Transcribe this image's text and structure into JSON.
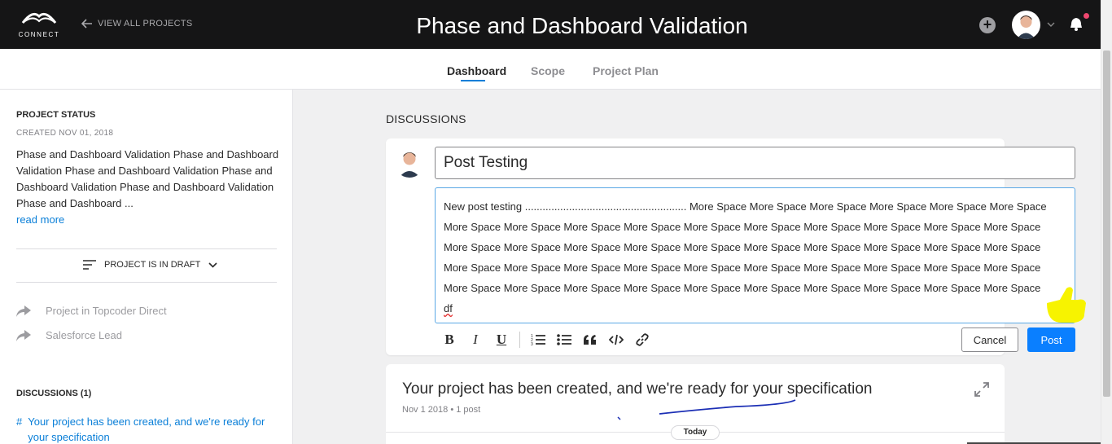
{
  "header": {
    "logo_text": "CONNECT",
    "back_link": "VIEW ALL PROJECTS",
    "title": "Phase and Dashboard Validation",
    "icons": [
      "add-circle-icon",
      "avatar",
      "chevron-down-icon",
      "bell-icon"
    ],
    "notification_dot_color": "#ef476f"
  },
  "tabs": [
    {
      "label": "Dashboard",
      "active": true
    },
    {
      "label": "Scope",
      "active": false
    },
    {
      "label": "Project Plan",
      "active": false
    }
  ],
  "sidebar": {
    "status_heading": "PROJECT STATUS",
    "created": "CREATED NOV 01, 2018",
    "description": "Phase and Dashboard Validation Phase and Dashboard Validation Phase and Dashboard Validation Phase and Dashboard Validation Phase and Dashboard Validation Phase and Dashboard ...",
    "read_more": "read more",
    "draft_label": "PROJECT IS IN DRAFT",
    "links": [
      "Project in Topcoder Direct",
      "Salesforce Lead"
    ],
    "discussions_heading": "DISCUSSIONS (1)",
    "discussion_link_hash": "#",
    "discussion_link": "Your project has been created, and we're ready for your specification"
  },
  "main": {
    "section_title": "DISCUSSIONS",
    "post_title_value": "Post Testing",
    "post_body_text": "New post testing ....................................................... More Space More Space More Space More Space More Space More Space More Space More Space More Space More Space More Space More Space More Space More Space More Space More Space More Space More Space More Space More Space More Space More Space More Space More Space More Space More Space More Space More Space More Space More Space More Space More Space More Space More Space More Space More Space More Space More Space More Space More Space More Space More Space More Space More Space More Space More Space",
    "post_body_last_line": "df",
    "toolbar": [
      "bold-icon",
      "italic-icon",
      "underline-icon",
      "ordered-list-icon",
      "bullet-list-icon",
      "quote-icon",
      "code-icon",
      "link-icon"
    ],
    "cancel_label": "Cancel",
    "post_label": "Post",
    "accent_color": "#0a7fff",
    "thread": {
      "title": "Your project has been created, and we're ready for your specification",
      "meta": "Nov 1 2018  •  1 post",
      "today_label": "Today"
    }
  }
}
